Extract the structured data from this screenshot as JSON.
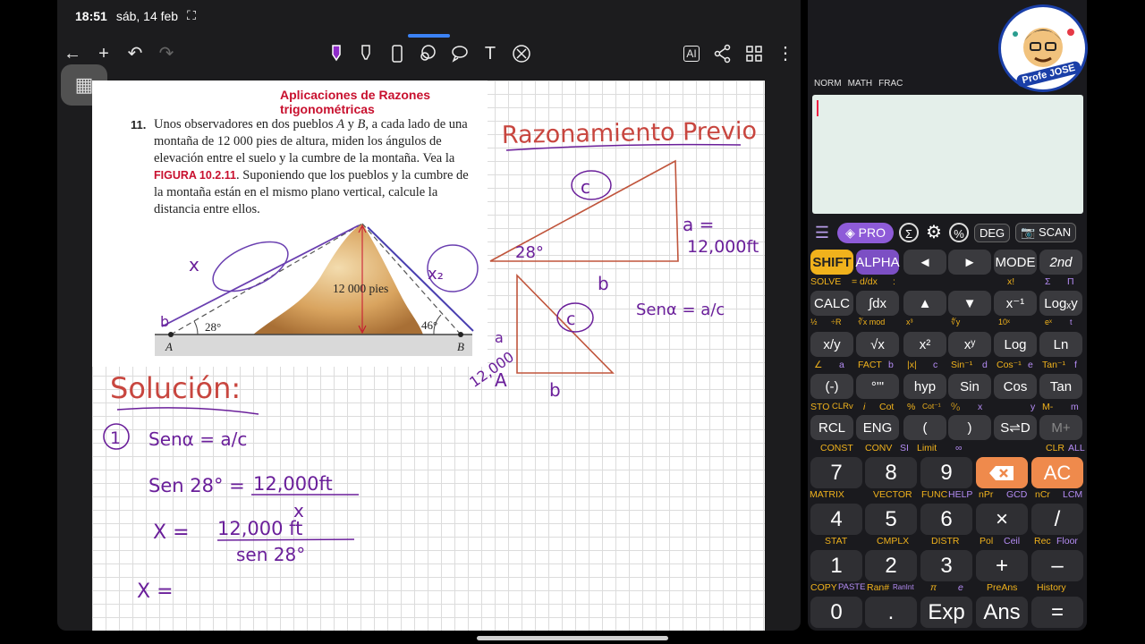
{
  "status": {
    "time": "18:51",
    "date": "sáb, 14 feb"
  },
  "toolbar": {
    "icons": [
      "back-arrow-icon",
      "add-icon",
      "undo-icon",
      "redo-icon",
      "pen-icon",
      "highlighter-icon",
      "eraser-icon",
      "lasso-icon",
      "shapes-icon",
      "text-icon",
      "laser-icon",
      "ai-icon",
      "share-icon",
      "grid-icon",
      "more-icon"
    ],
    "pen_color": "#8e2cc9",
    "ai_label": "AI"
  },
  "book": {
    "title": "Aplicaciones de Razones trigonométricas",
    "problem_number": "11.",
    "problem_text_1": "Unos observadores en dos pueblos ",
    "problem_A": "A",
    "problem_y": " y ",
    "problem_B": "B",
    "problem_text_2": ", a cada lado de una montaña de 12 000 pies de altura, miden los ángulos de elevación entre el suelo y la cumbre de la montaña. Vea la ",
    "figure_ref": "FIGURA 10.2.11",
    "problem_text_3": ". Suponiendo que los pueblos y la cumbre de la montaña están en el mismo plano vertical, calcule la distancia entre ellos.",
    "figure": {
      "height_label": "12 000 pies",
      "angle_left": "28°",
      "angle_right": "46°",
      "point_a": "A",
      "point_b": "B"
    }
  },
  "handwriting": {
    "razonamiento": "Razonamiento Previo",
    "c1": "c",
    "a_eq": "a =",
    "a_val": "12,000ft",
    "angle28": "28°",
    "b1": "b",
    "a2": "a",
    "a2_val": "12,000",
    "A2": "A",
    "c2": "c",
    "b2": "b",
    "sen_formula": "Senα = a/c",
    "x_top": "x",
    "x2": "x₂",
    "b_mark": "b",
    "solucion": "Solución:",
    "step1_num": "1",
    "step1": "Senα = a/c",
    "step2_left": "Sen 28° =",
    "step2_num": "12,000ft",
    "step2_den": "x",
    "step3_left": "X =",
    "step3_num": "12,000 ft",
    "step3_den": "sen 28°",
    "step4": "X ="
  },
  "calculator": {
    "status_items": [
      "NORM",
      "MATH",
      "FRAC"
    ],
    "display_value": "",
    "top_row": [
      "PRO",
      "DEG",
      "SCAN"
    ],
    "avatar_label": "Profe JOSE",
    "rows": [
      {
        "keys": [
          "SHIFT",
          "ALPHA",
          "◄",
          "►",
          "MODE",
          "2nd"
        ],
        "labels": [
          "SOLVE",
          "= d/dx",
          ":",
          "",
          "x!",
          "Σ",
          "Π"
        ]
      },
      {
        "keys": [
          "CALC",
          "∫dx",
          "▲",
          "▼",
          "x⁻¹",
          "Logₓy"
        ],
        "labels": [
          "½",
          "÷R",
          "∛x mod",
          "x³",
          "▯",
          "∜y",
          "10ˣ",
          "eˣ",
          "t"
        ]
      },
      {
        "keys": [
          "x/y",
          "√x",
          "x²",
          "xʸ",
          "Log",
          "Ln"
        ],
        "labels": [
          "∠",
          "a",
          "FACT",
          "b",
          "|x|",
          "c",
          "Sin⁻¹",
          "d",
          "Cos⁻¹",
          "e",
          "Tan⁻¹",
          "f"
        ]
      },
      {
        "keys": [
          "(-)",
          "°'\"",
          "hyp",
          "Sin",
          "Cos",
          "Tan"
        ],
        "labels": [
          "STO",
          "CLRv",
          "i",
          "Cot",
          "%",
          "Cot⁻¹",
          "⁰⁄₀",
          "x",
          "y",
          "M-",
          "m"
        ]
      },
      {
        "keys": [
          "RCL",
          "ENG",
          "(",
          ")",
          "S⇌D",
          "M+"
        ],
        "labels": [
          "CONST",
          "CONV",
          "SI",
          "Limit",
          "∞",
          "CLR",
          "ALL"
        ]
      },
      {
        "keys": [
          "7",
          "8",
          "9",
          "⌫",
          "AC"
        ],
        "labels": [
          "MATRIX",
          "VECTOR",
          "FUNC",
          "HELP",
          "nPr",
          "GCD",
          "nCr",
          "LCM"
        ]
      },
      {
        "keys": [
          "4",
          "5",
          "6",
          "×",
          "/"
        ],
        "labels": [
          "STAT",
          "CMPLX",
          "DISTR",
          "Pol",
          "Ceil",
          "Rec",
          "Floor"
        ]
      },
      {
        "keys": [
          "1",
          "2",
          "3",
          "+",
          "–"
        ],
        "labels": [
          "COPY",
          "PASTE",
          "Ran#",
          "RanInt",
          "π",
          "e",
          "PreAns",
          "History"
        ]
      },
      {
        "keys": [
          "0",
          ".",
          "Exp",
          "Ans",
          "="
        ]
      }
    ]
  }
}
